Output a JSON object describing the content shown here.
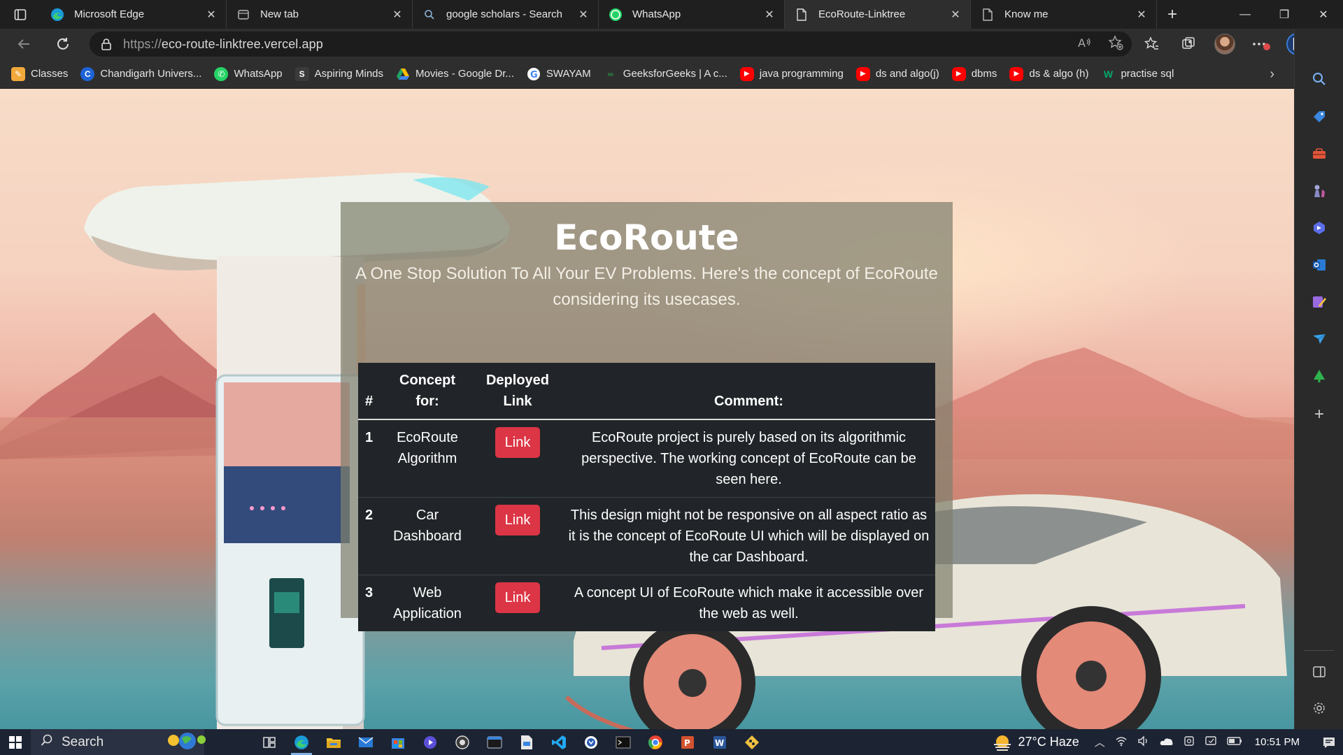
{
  "browser": {
    "tabs": [
      {
        "label": "Microsoft Edge",
        "icon": "edge-icon",
        "active": false
      },
      {
        "label": "New tab",
        "icon": "newtab-icon",
        "active": false
      },
      {
        "label": "google scholars - Search",
        "icon": "search-icon",
        "active": false
      },
      {
        "label": "WhatsApp",
        "icon": "whatsapp-icon",
        "active": false
      },
      {
        "label": "EcoRoute-Linktree",
        "icon": "page-icon",
        "active": true
      },
      {
        "label": "Know me",
        "icon": "page-icon",
        "active": false
      }
    ],
    "url_protocol": "https://",
    "url_host": "eco-route-linktree.vercel.app",
    "bookmarks": [
      {
        "label": "Classes",
        "icon": "classes-icon",
        "color": "#f2a93b"
      },
      {
        "label": "Chandigarh Univers...",
        "icon": "cu-icon",
        "color": "#1e63d6"
      },
      {
        "label": "WhatsApp",
        "icon": "whatsapp-icon",
        "color": "#25d366"
      },
      {
        "label": "Aspiring Minds",
        "icon": "aspiring-minds-icon",
        "color": "#3b3b3b"
      },
      {
        "label": "Movies - Google Dr...",
        "icon": "google-drive-icon",
        "color": "#1fa463"
      },
      {
        "label": "SWAYAM",
        "icon": "google-icon",
        "color": "#4285f4"
      },
      {
        "label": "GeeksforGeeks | A c...",
        "icon": "gfg-icon",
        "color": "#2f8d46"
      },
      {
        "label": "java programming",
        "icon": "youtube-icon",
        "color": "#ff0000"
      },
      {
        "label": "ds and algo(j)",
        "icon": "youtube-icon",
        "color": "#ff0000"
      },
      {
        "label": "dbms",
        "icon": "youtube-icon",
        "color": "#ff0000"
      },
      {
        "label": "ds & algo (h)",
        "icon": "youtube-icon",
        "color": "#ff0000"
      },
      {
        "label": "practise sql",
        "icon": "w3schools-icon",
        "color": "#04aa6d"
      }
    ]
  },
  "page": {
    "title": "EcoRoute",
    "subtitle": "A One Stop Solution To All Your EV Problems. Here's the concept of EcoRoute considering its usecases.",
    "table": {
      "headers": {
        "num": "#",
        "concept": "Concept for:",
        "deployed": "Deployed Link",
        "comment": "Comment:"
      },
      "rows": [
        {
          "num": "1",
          "concept": "EcoRoute Algorithm",
          "link": "Link",
          "comment": "EcoRoute project is purely based on its algorithmic perspective. The working concept of EcoRoute can be seen here."
        },
        {
          "num": "2",
          "concept": "Car Dashboard",
          "link": "Link",
          "comment": "This design might not be responsive on all aspect ratio as it is the concept of EcoRoute UI which will be displayed on the car Dashboard."
        },
        {
          "num": "3",
          "concept": "Web Application",
          "link": "Link",
          "comment": "A concept UI of EcoRoute which make it accessible over the web as well."
        }
      ]
    },
    "accent_color": "#dc3545"
  },
  "taskbar": {
    "search_label": "Search",
    "weather": "27°C Haze",
    "time": "10:51 PM"
  }
}
